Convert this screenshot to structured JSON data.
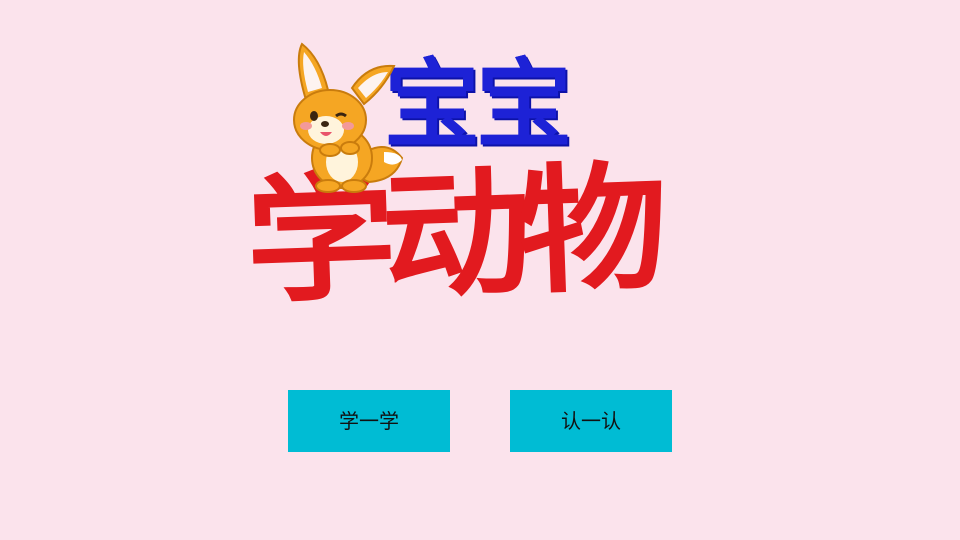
{
  "app": {
    "title_line_1": "宝宝",
    "title_line_2": "学动物",
    "mascot": "fox-mascot"
  },
  "buttons": {
    "learn_label": "学一学",
    "recognize_label": "认一认"
  },
  "colors": {
    "background": "#fbe3ec",
    "title_blue": "#1d22d6",
    "title_red": "#e21a1f",
    "button_bg": "#00bcd4"
  }
}
